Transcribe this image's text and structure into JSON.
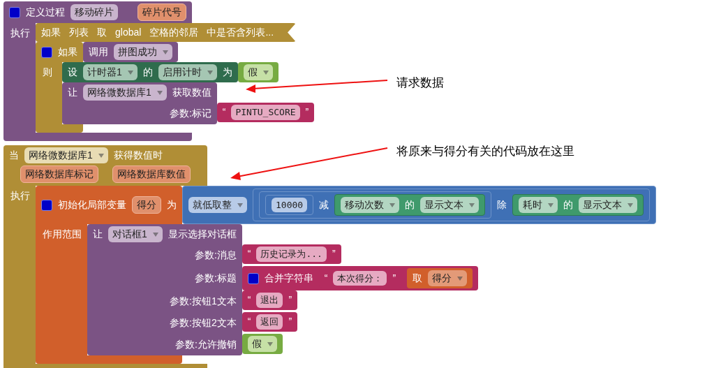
{
  "canvas": {
    "blocks": [
      {
        "kind": "procedure",
        "rows": [
          {
            "kind": "header",
            "parts": [
              {
                "kind": "mutator"
              },
              {
                "kind": "label",
                "text": "定义过程"
              },
              {
                "kind": "name",
                "text": "移动碎片"
              },
              {
                "kind": "param",
                "text": "碎片代号"
              }
            ]
          },
          {
            "kind": "statements",
            "label": "执行",
            "statements": [
              {
                "kind": "control",
                "collapsed": true,
                "rows": [
                  {
                    "kind": "header",
                    "parts": [
                      {
                        "kind": "label",
                        "text": "如果"
                      },
                      {
                        "kind": "label",
                        "text": "列表"
                      },
                      {
                        "kind": "label",
                        "text": "取"
                      },
                      {
                        "kind": "label",
                        "text": "global"
                      },
                      {
                        "kind": "label",
                        "text": "空格的邻居"
                      },
                      {
                        "kind": "label",
                        "text": "中是否含列表..."
                      }
                    ]
                  }
                ]
              },
              {
                "kind": "control",
                "rows": [
                  {
                    "kind": "header",
                    "parts": [
                      {
                        "kind": "mutator"
                      },
                      {
                        "kind": "label",
                        "text": "如果"
                      }
                    ],
                    "input": {
                      "kind": "procedure",
                      "rows": [
                        {
                          "kind": "header",
                          "parts": [
                            {
                              "kind": "label",
                              "text": "调用"
                            },
                            {
                              "kind": "dropdown",
                              "text": "拼图成功"
                            }
                          ]
                        }
                      ]
                    }
                  },
                  {
                    "kind": "statements",
                    "label": "则",
                    "statements": [
                      {
                        "kind": "setter",
                        "rows": [
                          {
                            "kind": "header",
                            "parts": [
                              {
                                "kind": "label",
                                "text": "设"
                              },
                              {
                                "kind": "dropdown",
                                "text": "计时器1"
                              },
                              {
                                "kind": "label",
                                "text": "的"
                              },
                              {
                                "kind": "dropdown",
                                "text": "启用计时"
                              },
                              {
                                "kind": "label",
                                "text": "为"
                              }
                            ],
                            "input": {
                              "kind": "logic",
                              "rows": [
                                {
                                  "kind": "header",
                                  "parts": [
                                    {
                                      "kind": "dropdown",
                                      "text": "假"
                                    }
                                  ]
                                }
                              ]
                            }
                          }
                        ]
                      },
                      {
                        "kind": "procedure",
                        "rows": [
                          {
                            "kind": "header",
                            "parts": [
                              {
                                "kind": "label",
                                "text": "让"
                              },
                              {
                                "kind": "dropdown",
                                "text": "网络微数据库1"
                              },
                              {
                                "kind": "label",
                                "text": "获取数值"
                              }
                            ]
                          },
                          {
                            "kind": "argument",
                            "parts": [
                              {
                                "kind": "label",
                                "text": "参数:标记"
                              }
                            ],
                            "input": {
                              "kind": "text",
                              "rows": [
                                {
                                  "kind": "header",
                                  "parts": [
                                    {
                                      "kind": "label",
                                      "text": "“"
                                    },
                                    {
                                      "kind": "text",
                                      "text": "PINTU_SCORE"
                                    },
                                    {
                                      "kind": "label",
                                      "text": "”"
                                    }
                                  ]
                                }
                              ]
                            }
                          }
                        ]
                      }
                    ]
                  }
                ]
              }
            ]
          }
        ]
      },
      {
        "kind": "control",
        "rows": [
          {
            "kind": "header",
            "parts": [
              {
                "kind": "label",
                "text": "当"
              },
              {
                "kind": "dropdown",
                "text": "网络微数据库1"
              },
              {
                "kind": "label",
                "text": "获得数值时"
              }
            ]
          },
          {
            "kind": "params",
            "parts": [
              {
                "kind": "param",
                "text": "网络数据库标记"
              },
              {
                "kind": "param",
                "text": "网络数据库数值"
              }
            ]
          },
          {
            "kind": "statements",
            "label": "执行",
            "statements": [
              {
                "kind": "variable",
                "rows": [
                  {
                    "kind": "header",
                    "parts": [
                      {
                        "kind": "mutator"
                      },
                      {
                        "kind": "label",
                        "text": "初始化局部变量"
                      },
                      {
                        "kind": "param",
                        "text": "得分"
                      },
                      {
                        "kind": "label",
                        "text": "为"
                      }
                    ],
                    "input": {
                      "kind": "math",
                      "rows": [
                        {
                          "kind": "header",
                          "parts": [
                            {
                              "kind": "dropdown",
                              "text": "就低取整"
                            },
                            {
                              "kind": "block",
                              "block": {
                                "kind": "math",
                                "rows": [
                                  {
                                    "kind": "header",
                                    "parts": [
                                      {
                                        "kind": "block",
                                        "block": {
                                          "kind": "math",
                                          "rows": [
                                            {
                                              "kind": "header",
                                              "parts": [
                                                {
                                                  "kind": "block",
                                                  "block": {
                                                    "kind": "math",
                                                    "rows": [
                                                      {
                                                        "kind": "header",
                                                        "parts": [
                                                          {
                                                            "kind": "number",
                                                            "text": "10000"
                                                          }
                                                        ]
                                                      }
                                                    ]
                                                  }
                                                },
                                                {
                                                  "kind": "label",
                                                  "text": "减"
                                                },
                                                {
                                                  "kind": "block",
                                                  "block": {
                                                    "kind": "getter",
                                                    "rows": [
                                                      {
                                                        "kind": "header",
                                                        "parts": [
                                                          {
                                                            "kind": "dropdown",
                                                            "text": "移动次数"
                                                          },
                                                          {
                                                            "kind": "label",
                                                            "text": "的"
                                                          },
                                                          {
                                                            "kind": "dropdown",
                                                            "text": "显示文本"
                                                          }
                                                        ]
                                                      }
                                                    ]
                                                  }
                                                }
                                              ]
                                            }
                                          ]
                                        }
                                      },
                                      {
                                        "kind": "label",
                                        "text": "除"
                                      },
                                      {
                                        "kind": "block",
                                        "block": {
                                          "kind": "getter",
                                          "rows": [
                                            {
                                              "kind": "header",
                                              "parts": [
                                                {
                                                  "kind": "dropdown",
                                                  "text": "耗时"
                                                },
                                                {
                                                  "kind": "label",
                                                  "text": "的"
                                                },
                                                {
                                                  "kind": "dropdown",
                                                  "text": "显示文本"
                                                }
                                              ]
                                            }
                                          ]
                                        }
                                      }
                                    ]
                                  }
                                ]
                              }
                            }
                          ]
                        }
                      ]
                    }
                  },
                  {
                    "kind": "statements",
                    "label": "作用范围",
                    "statements": [
                      {
                        "kind": "procedure",
                        "rows": [
                          {
                            "kind": "header",
                            "parts": [
                              {
                                "kind": "label",
                                "text": "让"
                              },
                              {
                                "kind": "dropdown",
                                "text": "对话框1"
                              },
                              {
                                "kind": "label",
                                "text": "显示选择对话框"
                              }
                            ]
                          },
                          {
                            "kind": "argument",
                            "parts": [
                              {
                                "kind": "label",
                                "text": "参数:消息"
                              }
                            ],
                            "input": {
                              "kind": "text",
                              "rows": [
                                {
                                  "kind": "header",
                                  "parts": [
                                    {
                                      "kind": "label",
                                      "text": "“"
                                    },
                                    {
                                      "kind": "text",
                                      "text": "历史记录为..."
                                    },
                                    {
                                      "kind": "label",
                                      "text": "”"
                                    }
                                  ]
                                }
                              ]
                            }
                          },
                          {
                            "kind": "argument",
                            "parts": [
                              {
                                "kind": "label",
                                "text": "参数:标题"
                              }
                            ],
                            "input": {
                              "kind": "text",
                              "rows": [
                                {
                                  "kind": "header",
                                  "parts": [
                                    {
                                      "kind": "mutator"
                                    },
                                    {
                                      "kind": "label",
                                      "text": "合并字符串"
                                    },
                                    {
                                      "kind": "block",
                                      "block": {
                                        "kind": "text",
                                        "rows": [
                                          {
                                            "kind": "header",
                                            "parts": [
                                              {
                                                "kind": "label",
                                                "text": "“"
                                              },
                                              {
                                                "kind": "text",
                                                "text": "本次得分："
                                              },
                                              {
                                                "kind": "label",
                                                "text": "”"
                                              }
                                            ]
                                          }
                                        ]
                                      }
                                    },
                                    {
                                      "kind": "block",
                                      "block": {
                                        "kind": "variable",
                                        "rows": [
                                          {
                                            "kind": "header",
                                            "parts": [
                                              {
                                                "kind": "label",
                                                "text": "取"
                                              },
                                              {
                                                "kind": "dropdown",
                                                "text": "得分"
                                              }
                                            ]
                                          }
                                        ]
                                      }
                                    }
                                  ]
                                }
                              ]
                            }
                          },
                          {
                            "kind": "argument",
                            "parts": [
                              {
                                "kind": "label",
                                "text": "参数:按钮1文本"
                              }
                            ],
                            "input": {
                              "kind": "text",
                              "rows": [
                                {
                                  "kind": "header",
                                  "parts": [
                                    {
                                      "kind": "label",
                                      "text": "“"
                                    },
                                    {
                                      "kind": "text",
                                      "text": "退出"
                                    },
                                    {
                                      "kind": "label",
                                      "text": "”"
                                    }
                                  ]
                                }
                              ]
                            }
                          },
                          {
                            "kind": "argument",
                            "parts": [
                              {
                                "kind": "label",
                                "text": "参数:按钮2文本"
                              }
                            ],
                            "input": {
                              "kind": "text",
                              "rows": [
                                {
                                  "kind": "header",
                                  "parts": [
                                    {
                                      "kind": "label",
                                      "text": "“"
                                    },
                                    {
                                      "kind": "text",
                                      "text": "返回"
                                    },
                                    {
                                      "kind": "label",
                                      "text": "”"
                                    }
                                  ]
                                }
                              ]
                            }
                          },
                          {
                            "kind": "argument",
                            "parts": [
                              {
                                "kind": "label",
                                "text": "参数:允许撤销"
                              }
                            ],
                            "input": {
                              "kind": "logic",
                              "rows": [
                                {
                                  "kind": "header",
                                  "parts": [
                                    {
                                      "kind": "dropdown",
                                      "text": "假"
                                    }
                                  ]
                                }
                              ]
                            }
                          }
                        ]
                      }
                    ]
                  }
                ]
              }
            ]
          }
        ]
      }
    ]
  },
  "annotations": [
    {
      "text": "请求数据"
    },
    {
      "text": "将原来与得分有关的代码放在这里"
    }
  ]
}
